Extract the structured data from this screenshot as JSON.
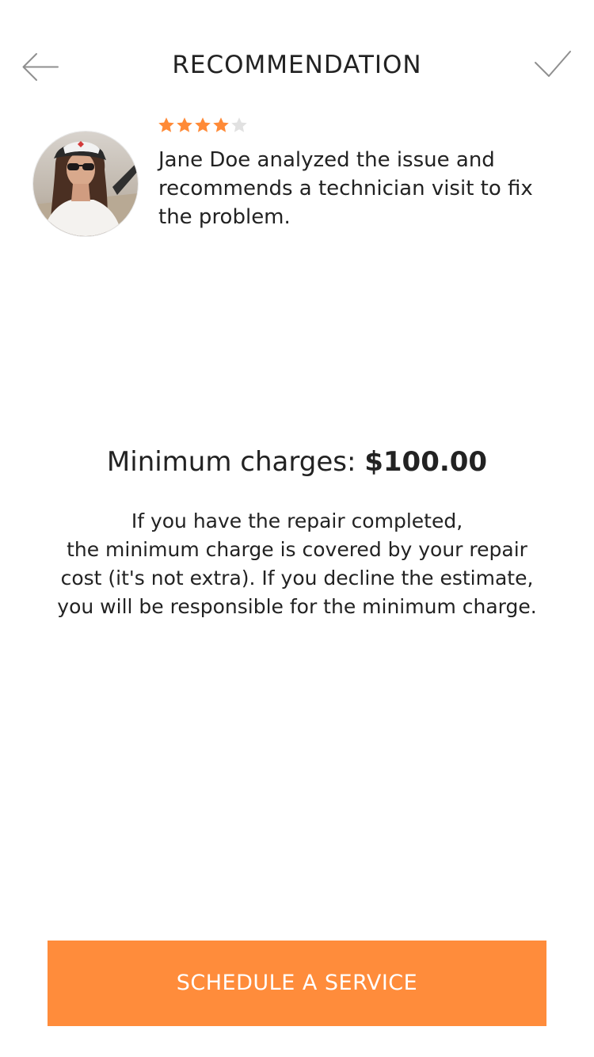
{
  "header": {
    "title": "RECOMMENDATION",
    "back_icon": "arrow-left-icon",
    "confirm_icon": "checkmark-icon"
  },
  "technician": {
    "avatar_icon": "profile-photo",
    "rating": 4,
    "rating_max": 5,
    "message": "Jane Doe analyzed the issue and recommends a technician visit to fix the problem."
  },
  "charges": {
    "label": "Minimum charges:",
    "amount": "$100.00",
    "note_lines": [
      "If you have the repair completed,",
      "the minimum charge is covered by your repair",
      "cost (it's not extra). If you decline the estimate,",
      "you will be responsible for the minimum charge."
    ]
  },
  "action": {
    "label": "SCHEDULE A SERVICE"
  },
  "colors": {
    "accent": "#ff8c3b",
    "star_filled": "#ff8a37",
    "star_empty": "#e1e1e1",
    "icon_stroke": "#8f8f8f",
    "text": "#222222"
  }
}
